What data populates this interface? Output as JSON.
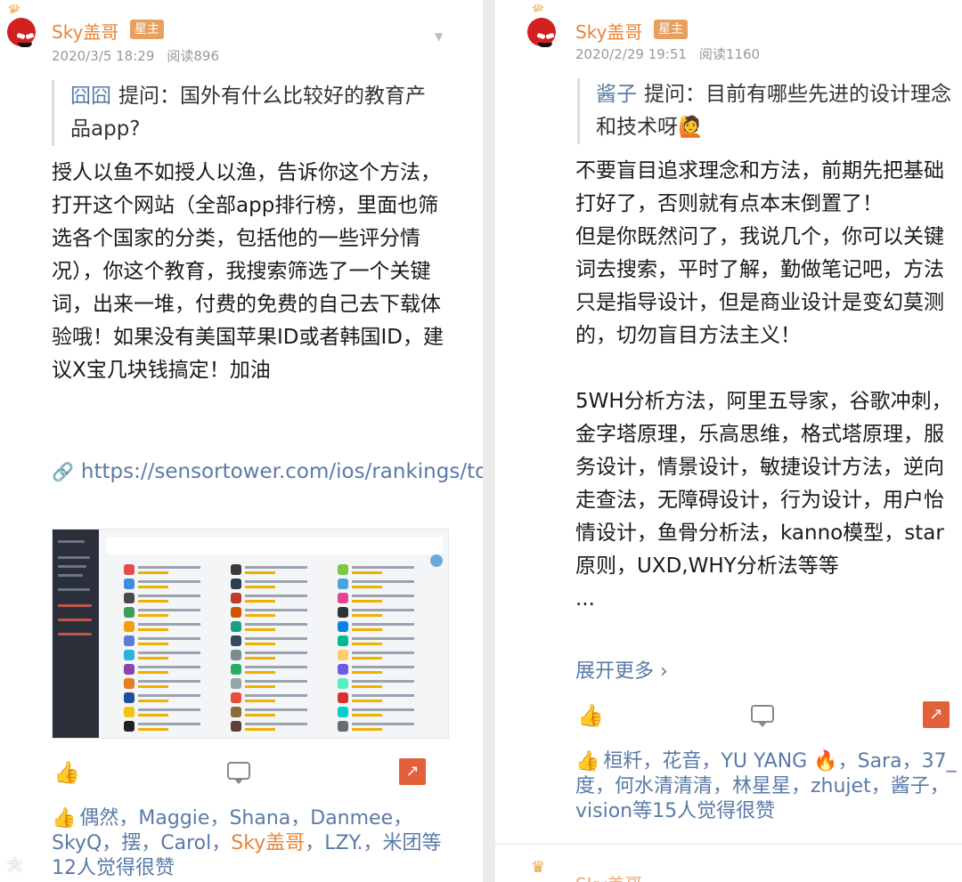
{
  "left": {
    "username": "Sky盖哥",
    "badge": "星主",
    "date": "2020/3/5 18:29",
    "reads": "阅读896",
    "question_name": "囧囧",
    "question_text": "提问：国外有什么比较好的教育产品app?",
    "answer": "授人以鱼不如授人以渔，告诉你这个方法，打开这个网站（全部app排行榜，里面也筛选各个国家的分类，包括他的一些评分情况），你这个教育，我搜索筛选了一个关键词，出来一堆，付费的免费的自己去下载体验哦！如果没有美国苹果ID或者韩国ID，建议X宝几块钱搞定！加油",
    "link": "https://sensortower.com/ios/rankings/top/iphone/us...",
    "likers_before": "偶然，Maggie，Shana，Danmee，SkyQ，摆，Carol，",
    "likers_highlight": "Sky盖哥",
    "likers_after": "，LZY.，米团等12人觉得很赞",
    "watermark": "大",
    "icons": {
      "like": "like-icon",
      "comment": "comment-icon",
      "share": "share-icon",
      "link": "link-icon"
    }
  },
  "right": {
    "username": "Sky盖哥",
    "badge": "星主",
    "date": "2020/2/29 19:51",
    "reads": "阅读1160",
    "question_name": "酱子",
    "question_text": "提问：目前有哪些先进的设计理念和技术呀🙋",
    "answer": "不要盲目追求理念和方法，前期先把基础打好了，否则就有点本末倒置了！\n但是你既然问了，我说几个，你可以关键词去搜索，平时了解，勤做笔记吧，方法只是指导设计，但是商业设计是变幻莫测的，切勿盲目方法主义！\n\n5WH分析方法，阿里五导家，谷歌冲刺，金字塔原理，乐高思维，格式塔原理，服务设计，情景设计，敏捷设计方法，逆向走查法，无障碍设计，行为设计，用户怡情设计，鱼骨分析法，kanno模型，star原则，UXD,WHY分析法等等\n...",
    "expand": "展开更多 ›",
    "likers": "桓粁，花音，YU YANG 🔥，Sara，37_度，何水清清清，林星星，zhujet，酱子，vision等15人觉得很赞",
    "next_username": "Sky盖哥"
  }
}
